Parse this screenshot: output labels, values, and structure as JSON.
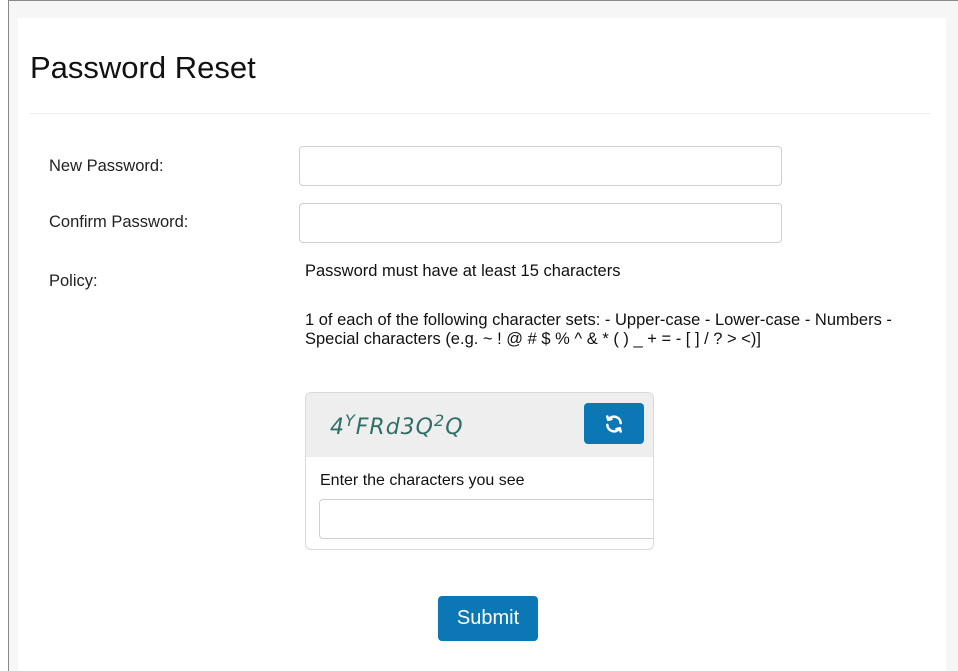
{
  "page": {
    "title": "Password Reset"
  },
  "form": {
    "new_password_label": "New Password:",
    "new_password_value": "",
    "confirm_password_label": "Confirm Password:",
    "confirm_password_value": "",
    "policy_label": "Policy:",
    "policy_line1": "Password must have at least 15 characters",
    "policy_line2": "1 of each of the following character sets: - Upper-case - Lower-case - Numbers - Special characters (e.g. ~ ! @ # $ % ^ & * ( ) _ + = - [ ] / ? > <)]"
  },
  "captcha": {
    "code_parts": [
      "4",
      "Y",
      "FRd3Q",
      "2",
      "Q"
    ],
    "refresh_icon": "refresh-icon",
    "prompt": "Enter the characters you see",
    "input_value": ""
  },
  "actions": {
    "submit_label": "Submit"
  },
  "colors": {
    "accent": "#0b78b5",
    "captcha_text": "#2e6f66"
  }
}
